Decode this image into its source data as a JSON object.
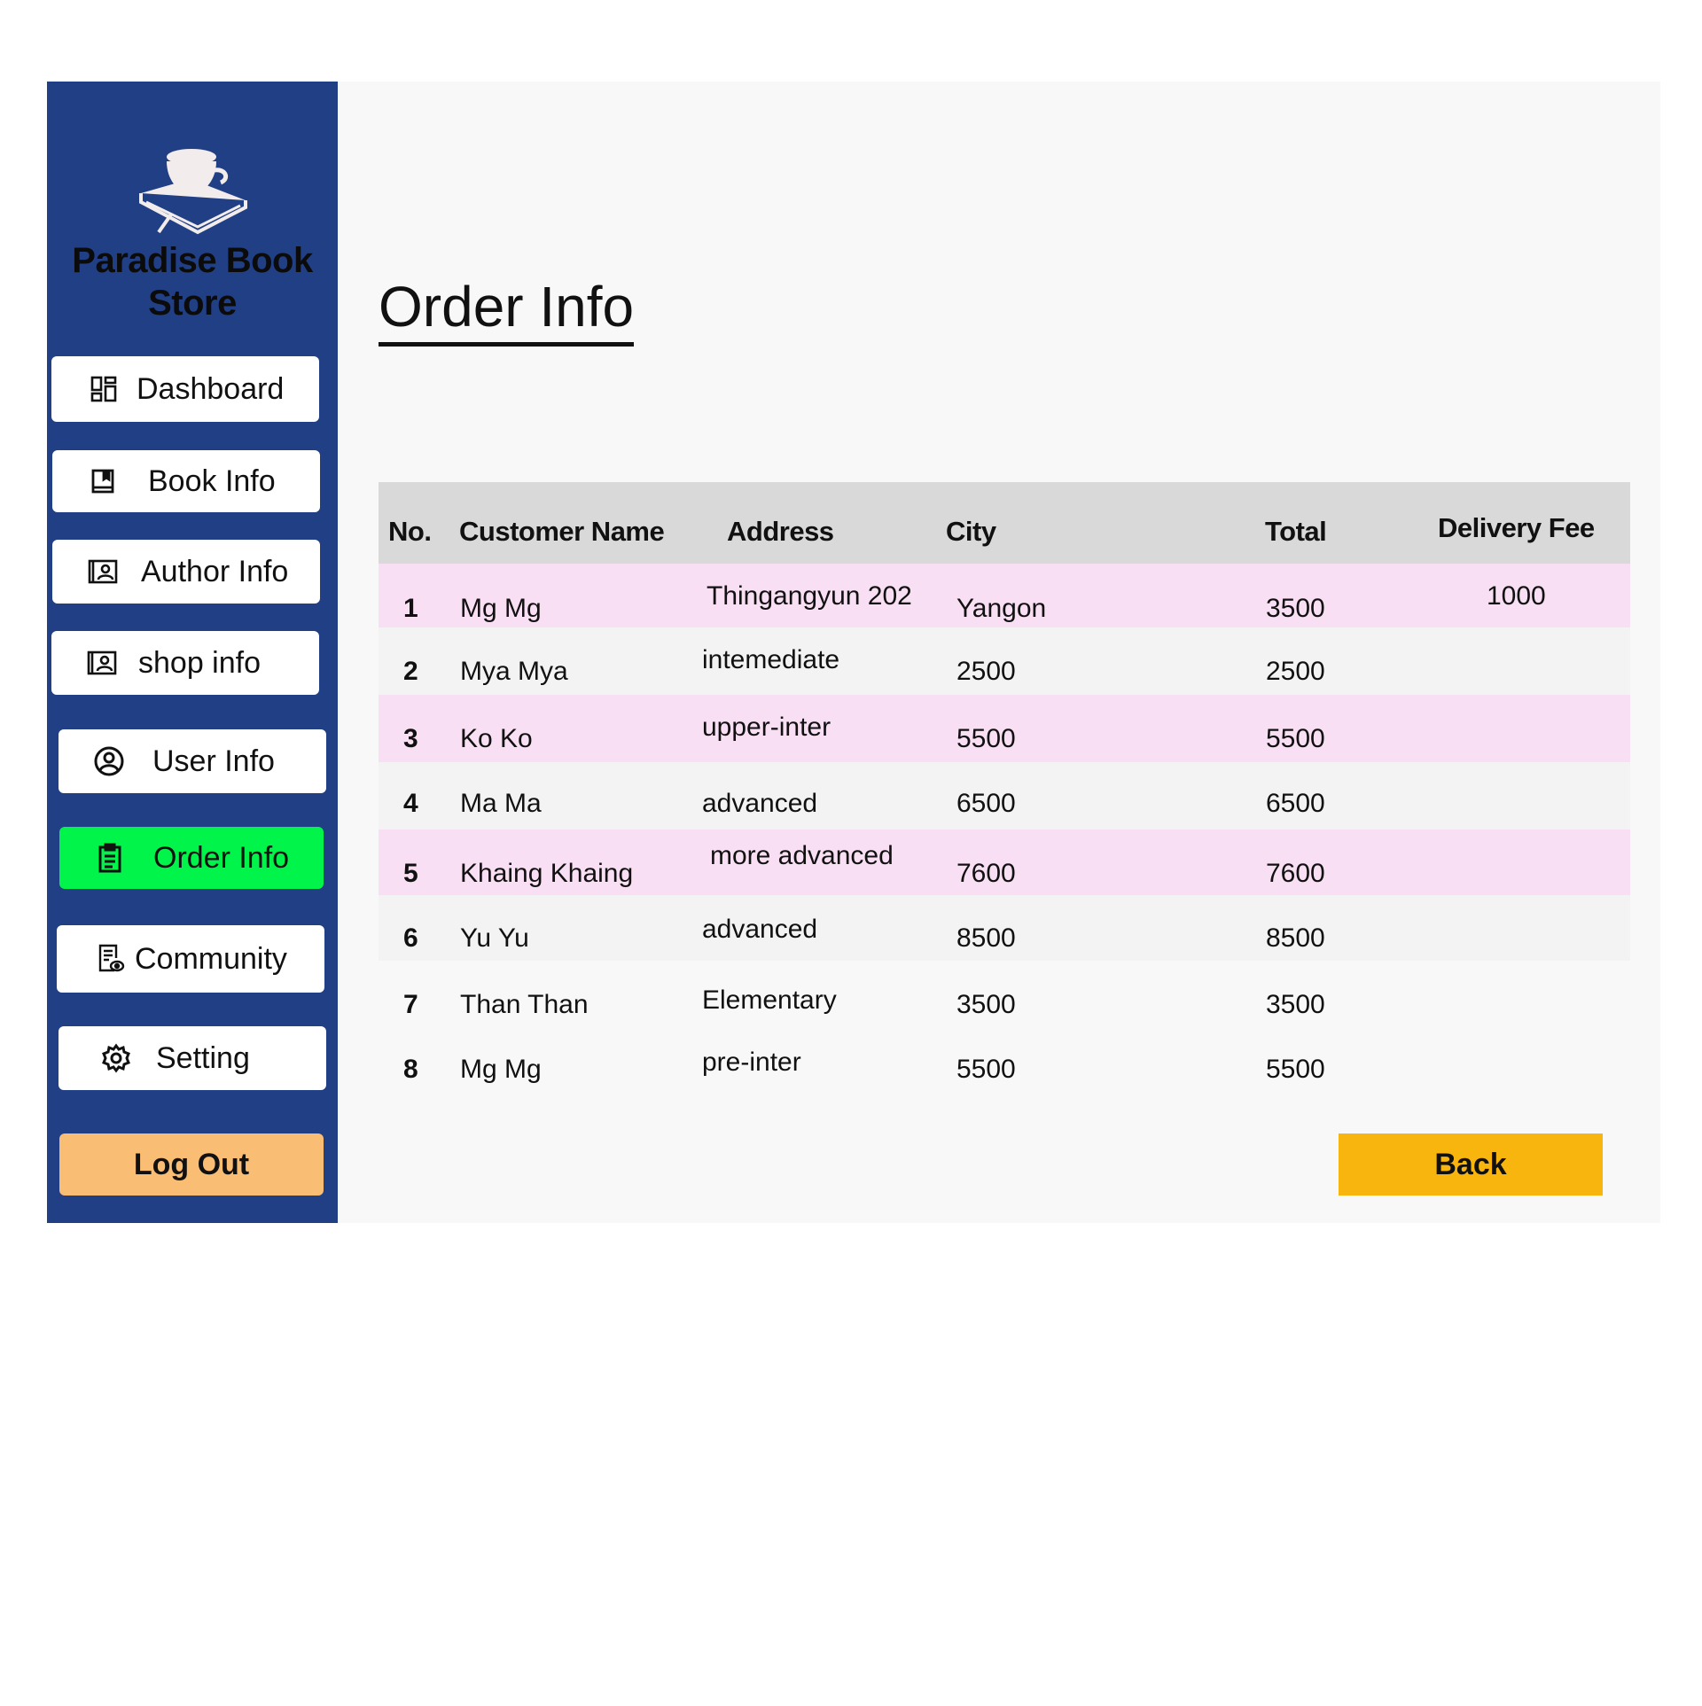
{
  "brand": {
    "name": "Paradise Book Store",
    "logo": "book-with-cup-icon"
  },
  "sidebar": {
    "items": [
      {
        "label": "Dashboard",
        "icon": "dashboard-icon"
      },
      {
        "label": "Book Info",
        "icon": "book-icon"
      },
      {
        "label": "Author Info",
        "icon": "id-card-icon"
      },
      {
        "label": "shop info",
        "icon": "id-card-icon"
      },
      {
        "label": "User Info",
        "icon": "user-circle-icon"
      },
      {
        "label": "Order Info",
        "icon": "clipboard-icon",
        "active": true
      },
      {
        "label": "Community",
        "icon": "document-eye-icon"
      },
      {
        "label": "Setting",
        "icon": "gear-icon"
      }
    ],
    "logout_label": "Log Out"
  },
  "main": {
    "title": "Order Info",
    "back_label": "Back"
  },
  "table": {
    "columns": [
      "No.",
      "Customer Name",
      "Address",
      "City",
      "Total",
      "Delivery Fee"
    ],
    "rows": [
      {
        "no": "1",
        "name": "Mg Mg",
        "address": "Thingangyun 202",
        "city": "Yangon",
        "total": "3500",
        "fee": "1000"
      },
      {
        "no": "2",
        "name": "Mya Mya",
        "address": "intemediate",
        "city": "2500",
        "total": "2500",
        "fee": ""
      },
      {
        "no": "3",
        "name": "Ko Ko",
        "address": "upper-inter",
        "city": "5500",
        "total": "5500",
        "fee": ""
      },
      {
        "no": "4",
        "name": "Ma Ma",
        "address": "advanced",
        "city": "6500",
        "total": "6500",
        "fee": ""
      },
      {
        "no": "5",
        "name": "Khaing Khaing",
        "address": "more advanced",
        "city": "7600",
        "total": "7600",
        "fee": ""
      },
      {
        "no": "6",
        "name": "Yu Yu",
        "address": "advanced",
        "city": "8500",
        "total": "8500",
        "fee": ""
      },
      {
        "no": "7",
        "name": "Than Than",
        "address": "Elementary",
        "city": "3500",
        "total": "3500",
        "fee": ""
      },
      {
        "no": "8",
        "name": "Mg Mg",
        "address": "pre-inter",
        "city": "5500",
        "total": "5500",
        "fee": ""
      }
    ]
  },
  "colors": {
    "sidebar": "#213f84",
    "active_nav": "#00f44a",
    "logout": "#f9bd73",
    "back": "#f7b50d",
    "row_pink": "#f9dff3",
    "row_gray": "#f3f3f3",
    "header": "#d9d9d9"
  }
}
